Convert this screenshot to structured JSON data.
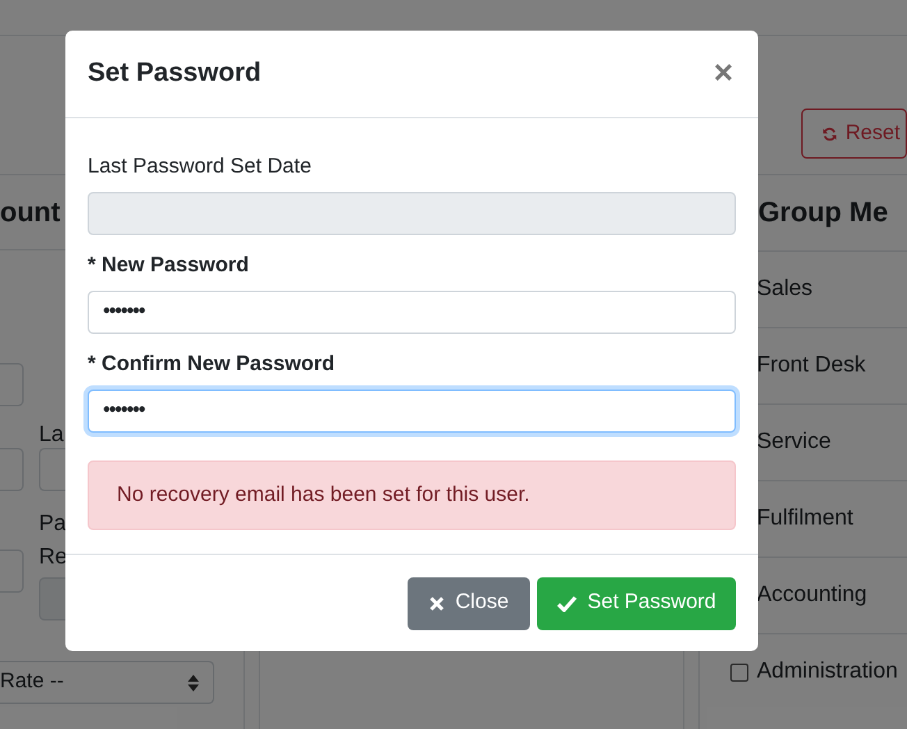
{
  "background_page": {
    "reset_button": "Reset",
    "account_panel": {
      "title_fragment": "ount",
      "labels": [
        "La",
        "Pa",
        "Re"
      ],
      "select_text": "Rate --"
    },
    "group_panel": {
      "title": "Group Me",
      "items": [
        {
          "label": "Sales"
        },
        {
          "label": "Front Desk"
        },
        {
          "label": "Service"
        },
        {
          "label": "Fulfilment"
        },
        {
          "label": "Accounting"
        },
        {
          "label": "Administration",
          "checked": false
        }
      ]
    }
  },
  "modal": {
    "title": "Set Password",
    "close_glyph": "×",
    "fields": [
      {
        "kind": "readonly",
        "label": "Last Password Set Date",
        "required": false
      },
      {
        "kind": "password",
        "label": "* New Password",
        "required": true,
        "value": "•••••••",
        "focused": false
      },
      {
        "kind": "password",
        "label": "* Confirm New Password",
        "required": true,
        "value": "•••••••",
        "focused": true
      }
    ],
    "alert": {
      "kind": "danger",
      "text": "No recovery email has been set for this user."
    },
    "buttons": [
      {
        "kind": "secondary",
        "label": "Close"
      },
      {
        "kind": "success",
        "label": "Set Password"
      }
    ]
  }
}
